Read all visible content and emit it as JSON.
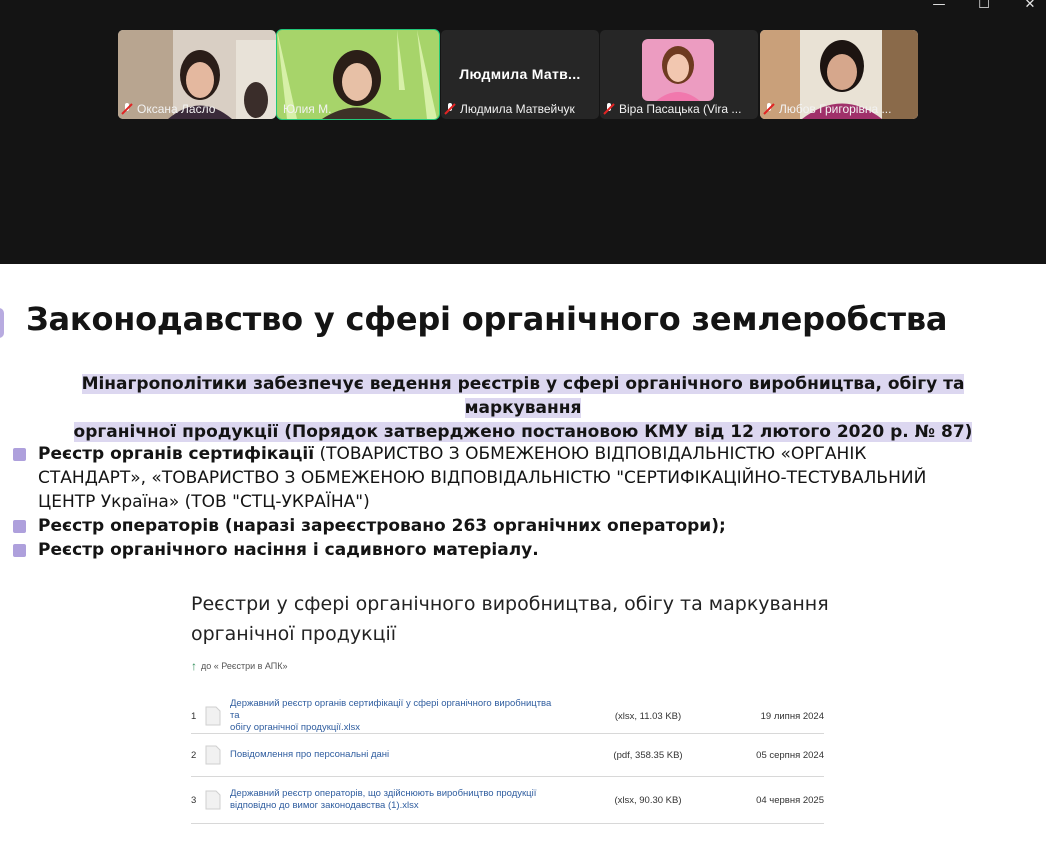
{
  "window_controls": {
    "minimize": "—",
    "maximize": "☐",
    "close": "✕"
  },
  "participants": [
    {
      "name": "Оксана Ласло",
      "muted": true,
      "active": false
    },
    {
      "name": "Юлия М.",
      "muted": false,
      "active": true
    },
    {
      "name": "Людмила Матвейчук",
      "display_name": "Людмила  Матв...",
      "muted": true,
      "active": false
    },
    {
      "name": "Віра Пасацька (Vira ...",
      "muted": true,
      "active": false
    },
    {
      "name": "Любов Григорівна ...",
      "muted": true,
      "active": false
    }
  ],
  "slide": {
    "title": "Законодавство у сфері органічного землеробства",
    "highlight_line1": "Мінагрополітики забезпечує ведення реєстрів у сфері органічного виробництва, обігу та маркування",
    "highlight_line2": "органічної продукції (Порядок затверджено постановою КМУ від 12 лютого 2020 р. № 87)",
    "bullets": [
      {
        "bold": "Реєстр органів сертифікації",
        "rest": " (ТОВАРИСТВО З ОБМЕЖЕНОЮ ВІДПОВІДАЛЬНІСТЮ «ОРГАНІК СТАНДАРТ», «ТОВАРИСТВО З ОБМЕЖЕНОЮ ВІДПОВІДАЛЬНІСТЮ \"СЕРТИФІКАЦІЙНО-ТЕСТУВАЛЬНИЙ ЦЕНТР Україна» (ТОВ \"СТЦ-УКРАЇНА\")"
      },
      {
        "bold": "Реєстр операторів (наразі зареєстровано 263 органічних оператори);",
        "rest": ""
      },
      {
        "bold": "Реєстр органічного насіння і садивного матеріалу.",
        "rest": ""
      }
    ],
    "embedded": {
      "title_line1": "Реєстри у сфері органічного виробництва, обігу та маркування",
      "title_line2": "органічної продукції",
      "back_link": "до « Реєстри в АПК»",
      "rows": [
        {
          "num": "1",
          "link_line1": "Державний реєстр органів сертифікації у сфері органічного виробництва та",
          "link_line2": "обігу органічної продукції.xlsx",
          "meta": "(xlsx, 11.03 KB)",
          "date": "19 липня 2024"
        },
        {
          "num": "2",
          "link_line1": "Повідомлення про персональні дані",
          "link_line2": "",
          "meta": "(pdf, 358.35 KB)",
          "date": "05 серпня 2024"
        },
        {
          "num": "3",
          "link_line1": "Державний реєстр операторів, що здійснюють виробництво продукції",
          "link_line2": "відповідно до вимог законодавства (1).xlsx",
          "meta": "(xlsx, 90.30 KB)",
          "date": "04 червня 2025"
        }
      ]
    }
  }
}
